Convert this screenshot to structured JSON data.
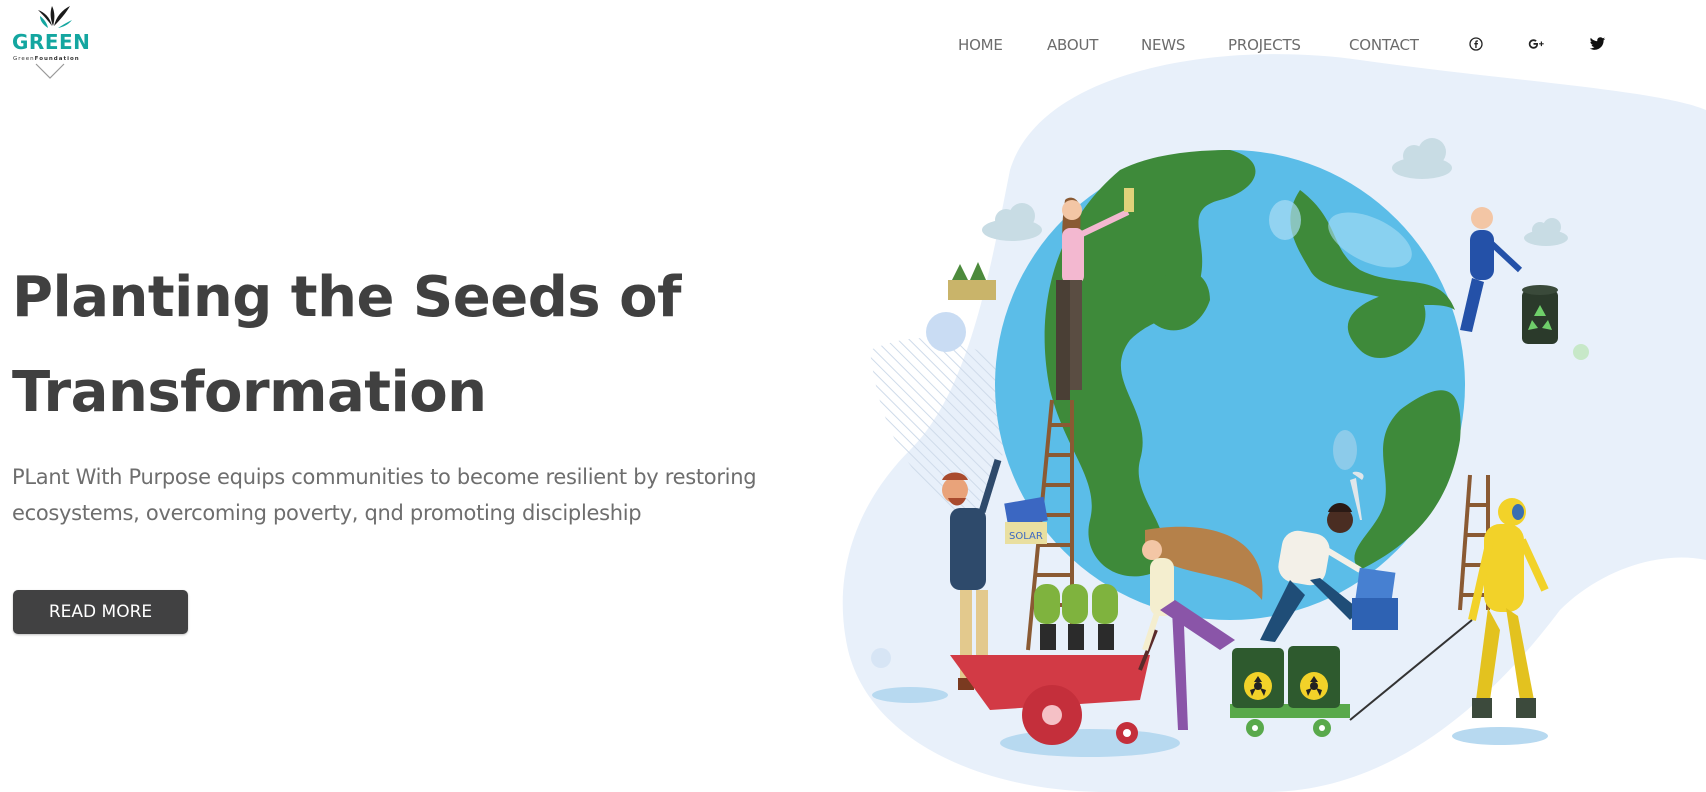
{
  "logo": {
    "title": "GREEN",
    "sub_prefix": "Green",
    "sub_bold": "Foundation"
  },
  "nav": {
    "items": [
      {
        "label": "HOME"
      },
      {
        "label": "ABOUT"
      },
      {
        "label": "NEWS"
      },
      {
        "label": "PROJECTS"
      },
      {
        "label": "CONTACT"
      }
    ],
    "social": [
      "facebook-icon",
      "google-plus-icon",
      "twitter-icon"
    ]
  },
  "hero": {
    "title_line1": "Planting the Seeds of",
    "title_line2": "Transformation",
    "desc_line1": "PLant With Purpose equips communities to become resilient by restoring",
    "desc_line2": "ecosystems, overcoming poverty, qnd promoting discipleship",
    "button_label": "READ MORE",
    "solar_label": "SOLAR"
  },
  "colors": {
    "brand_teal": "#14a6a0",
    "dark_text": "#404040",
    "button_bg": "#414142",
    "blob_bg": "#e8f0fa",
    "ocean": "#5bbde8",
    "land": "#3e8a3a"
  }
}
